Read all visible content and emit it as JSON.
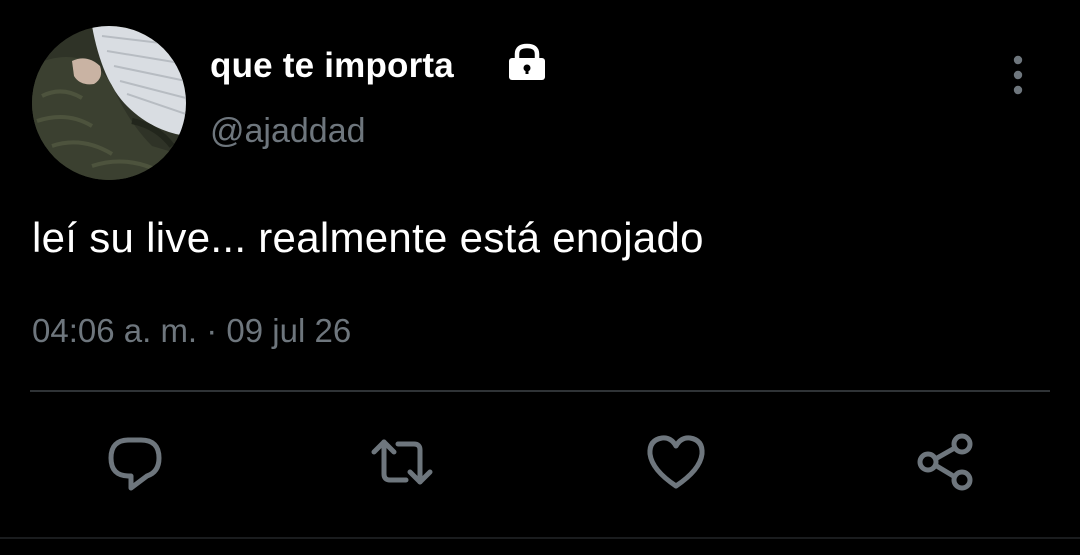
{
  "tweet": {
    "display_name": "que te importa",
    "handle": "@ajaddad",
    "text": "leí su live... realmente está enojado",
    "timestamp": "04:06 a. m. · 09 jul 26",
    "protected": true
  },
  "icons": {
    "lock": "lock-icon",
    "more": "more-vertical-icon",
    "reply": "reply-icon",
    "retweet": "retweet-icon",
    "like": "heart-icon",
    "share": "share-icon"
  },
  "colors": {
    "background": "#000000",
    "primary_text": "#ffffff",
    "secondary_text": "#6e767d",
    "divider": "#2f3336",
    "icon": "#6e767d"
  }
}
